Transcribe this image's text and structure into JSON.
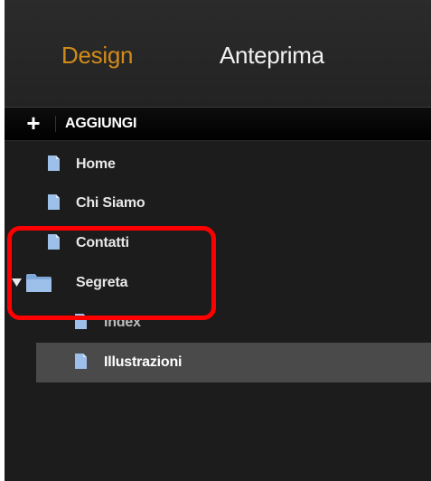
{
  "tabs": {
    "design_label": "Design",
    "preview_label": "Anteprima"
  },
  "toolbar": {
    "add_symbol": "+",
    "add_label": "AGGIUNGI"
  },
  "tree": {
    "items": [
      {
        "label": "Home",
        "icon": "page-icon"
      },
      {
        "label": "Chi Siamo",
        "icon": "page-icon"
      },
      {
        "label": "Contatti",
        "icon": "page-icon"
      },
      {
        "label": "Segreta",
        "icon": "folder-icon",
        "expanded": true
      },
      {
        "label": "Index",
        "icon": "page-icon",
        "child": true
      },
      {
        "label": "Illustrazioni",
        "icon": "page-icon",
        "child": true,
        "selected": true
      }
    ]
  },
  "colors": {
    "active_tab": "#d08b1a",
    "highlight": "#ff0000",
    "icon": "#9dc0ea",
    "selected_row": "#4a4a4a"
  }
}
